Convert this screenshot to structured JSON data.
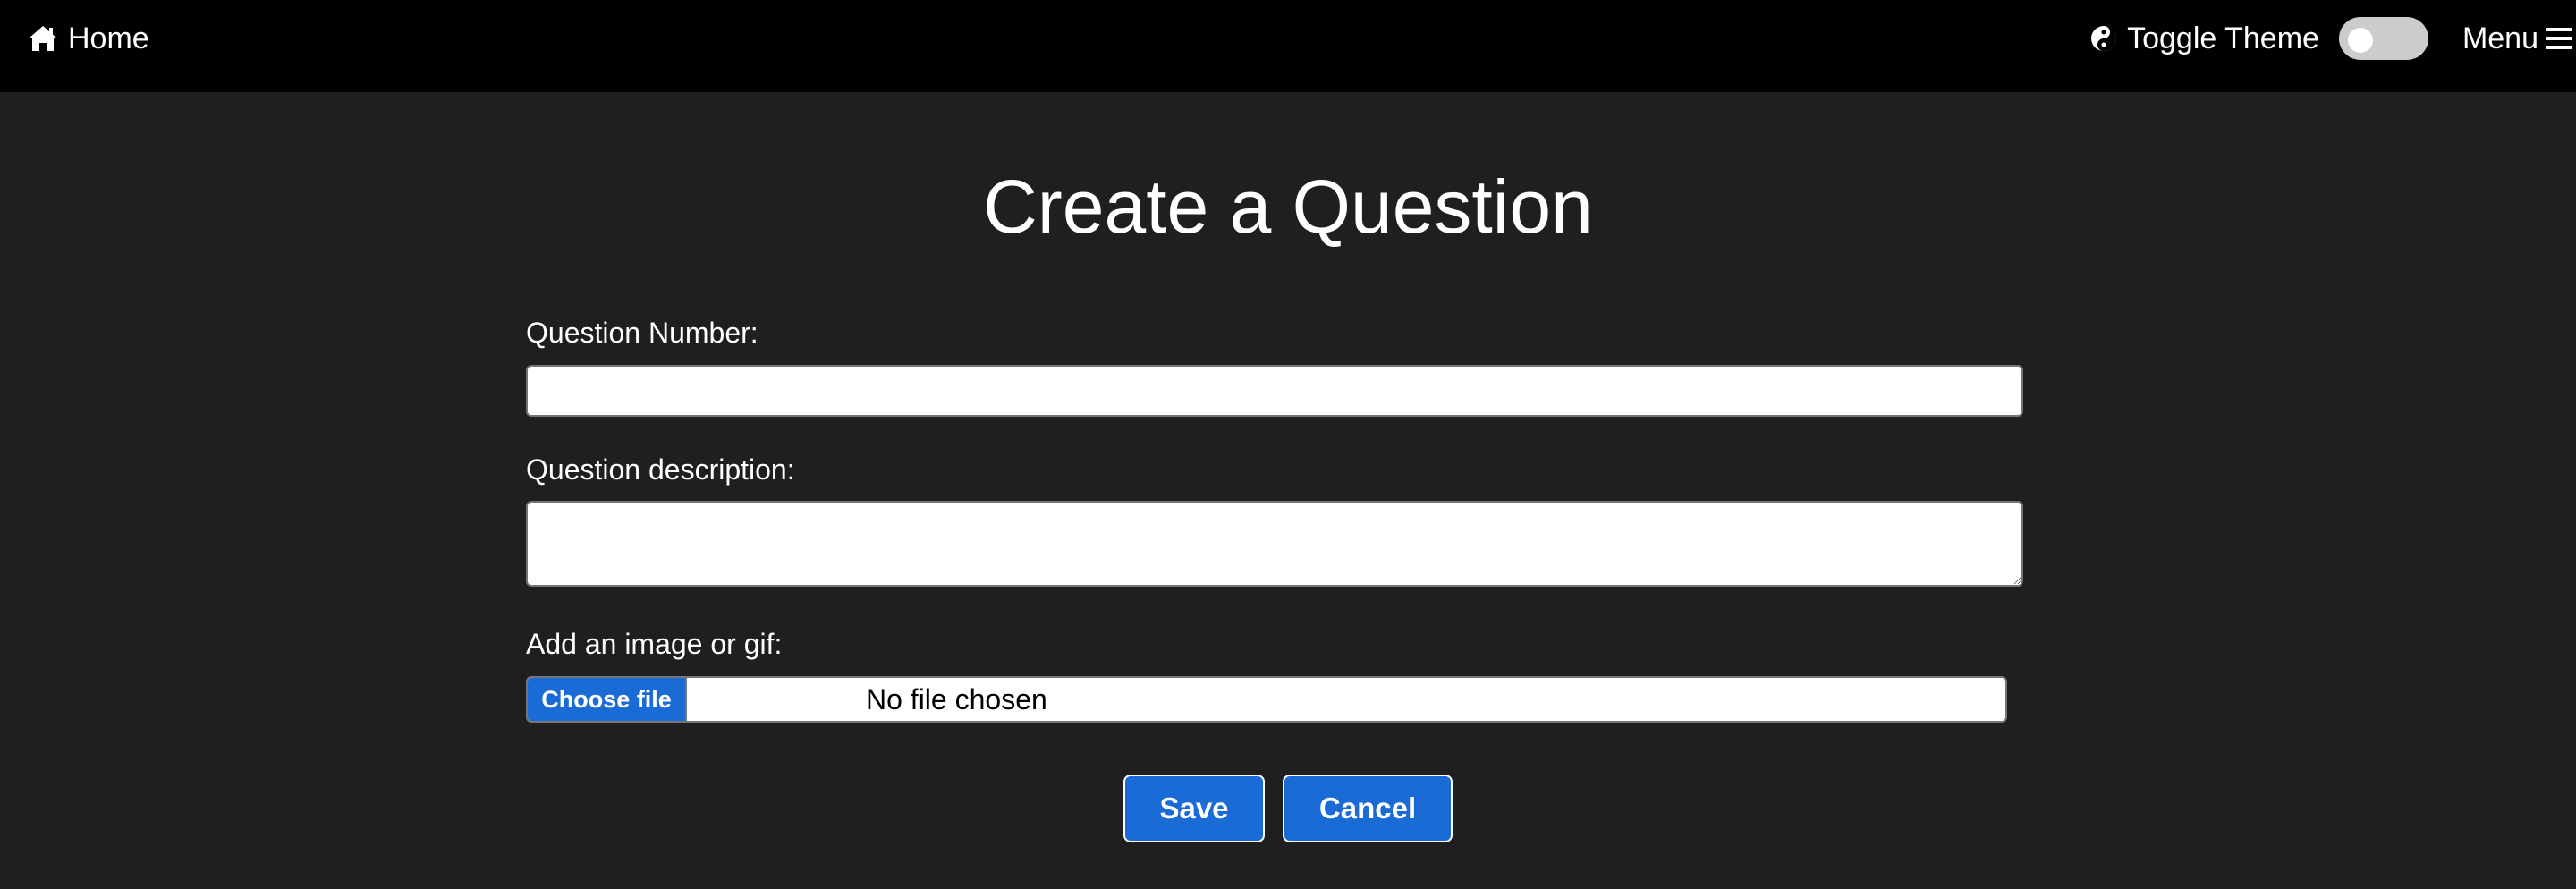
{
  "navbar": {
    "home_label": "Home",
    "home_icon": "home-icon",
    "theme_label": "Toggle Theme",
    "theme_icon": "yin-yang-icon",
    "theme_toggle_on": false,
    "menu_label": "Menu",
    "menu_icon": "hamburger-icon"
  },
  "page": {
    "title": "Create a Question"
  },
  "form": {
    "question_number": {
      "label": "Question Number:",
      "value": ""
    },
    "question_description": {
      "label": "Question description:",
      "value": ""
    },
    "image": {
      "label": "Add an image or gif:",
      "button_label": "Choose file",
      "status": "No file chosen"
    },
    "save_label": "Save",
    "cancel_label": "Cancel"
  },
  "colors": {
    "navbar_bg": "#000000",
    "page_bg": "#1f1f1f",
    "accent": "#1a6bd6",
    "toggle_off": "#cccccc"
  }
}
